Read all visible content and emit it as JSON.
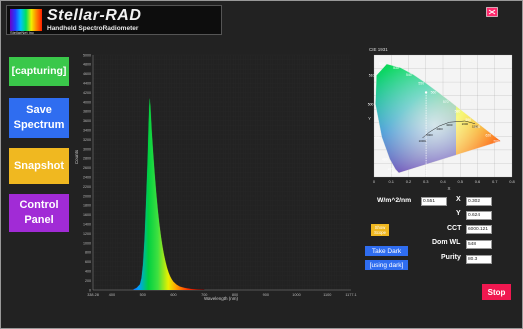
{
  "header": {
    "brand_title": "Stellar-RAD",
    "brand_subtitle": "Handheld SpectroRadiometer",
    "company": "StellarNet Inc"
  },
  "sidebar": {
    "capture_label": "[capturing]",
    "save_label": "Save Spectrum",
    "snapshot_label": "Snapshot",
    "control_panel_label": "Control Panel"
  },
  "spectrum": {
    "ylabel": "Counts",
    "xlabel": "Wavelength (nm)"
  },
  "chart_data": [
    {
      "type": "area",
      "title": "",
      "xlabel": "Wavelength (nm)",
      "ylabel": "Counts",
      "xlim": [
        338.28,
        1177.1
      ],
      "ylim": [
        0,
        5000
      ],
      "x_ticks": [
        "338.28",
        "400",
        "500",
        "600",
        "700",
        "800",
        "900",
        "1000",
        "1100",
        "1177.1"
      ],
      "y_ticks": [
        "0",
        "200",
        "400",
        "600",
        "800",
        "1000",
        "1200",
        "1400",
        "1600",
        "1800",
        "2000",
        "2200",
        "2400",
        "2600",
        "2800",
        "3000",
        "3200",
        "3400",
        "3600",
        "3800",
        "4000",
        "4200",
        "4400",
        "4600",
        "4800",
        "5000"
      ],
      "x": [
        470,
        480,
        490,
        495,
        500,
        505,
        510,
        515,
        518,
        520,
        522,
        524,
        526,
        528,
        530,
        535,
        540,
        545,
        550,
        555,
        560,
        565,
        570,
        575,
        580,
        585,
        590,
        595,
        600,
        610,
        620,
        630,
        640,
        650,
        660,
        680,
        700
      ],
      "y": [
        20,
        50,
        120,
        250,
        550,
        1100,
        1900,
        2800,
        3500,
        3900,
        4100,
        4050,
        3900,
        3650,
        3400,
        2900,
        2450,
        2050,
        1700,
        1400,
        1150,
        930,
        750,
        600,
        470,
        370,
        290,
        230,
        180,
        120,
        80,
        60,
        45,
        35,
        25,
        15,
        10
      ],
      "grid": true
    },
    {
      "type": "scatter",
      "title": "CIE 1931",
      "xlabel": "X",
      "ylabel": "Y",
      "xlim": [
        0,
        0.8
      ],
      "ylim": [
        0,
        0.9
      ],
      "x_ticks": [
        "0",
        "0.1",
        "0.2",
        "0.3",
        "0.4",
        "0.5",
        "0.6",
        "0.7",
        "0.8"
      ],
      "y_ticks": [
        "0",
        "0.1",
        "0.2",
        "0.3",
        "0.4",
        "0.5",
        "0.6",
        "0.7",
        "0.8",
        "0.9"
      ],
      "locus_labels": [
        "460",
        "470",
        "480",
        "490",
        "500",
        "510",
        "520",
        "530",
        "540",
        "550",
        "560",
        "570",
        "580",
        "590",
        "600",
        "620",
        "700"
      ],
      "planckian_labels": [
        "1500",
        "2000",
        "3000",
        "4000",
        "6000",
        "10000"
      ],
      "series": [
        {
          "x": [
            0.302
          ],
          "y": [
            0.624
          ]
        }
      ],
      "grid": true
    }
  ],
  "measurements": {
    "irradiance_label": "W/m^2/nm",
    "irradiance_value": "0.551",
    "x_label": "X",
    "x_value": "0.302",
    "y_label": "Y",
    "y_value": "0.624",
    "cct_label": "CCT",
    "cct_value": "6000.121",
    "domwl_label": "Dom WL",
    "domwl_value": "548",
    "purity_label": "Purity",
    "purity_value": "80.3"
  },
  "controls": {
    "show_scope_label": "Show Scope",
    "take_dark_label": "Take Dark",
    "using_dark_label": "[using dark]",
    "stop_label": "Stop"
  },
  "colors": {
    "capture": "#3ac84a",
    "save": "#2f6df0",
    "snapshot": "#f0b820",
    "control_panel": "#a12bd6",
    "stop": "#f01850",
    "take_dark": "#2f6df0",
    "show_scope": "#f0b820"
  }
}
